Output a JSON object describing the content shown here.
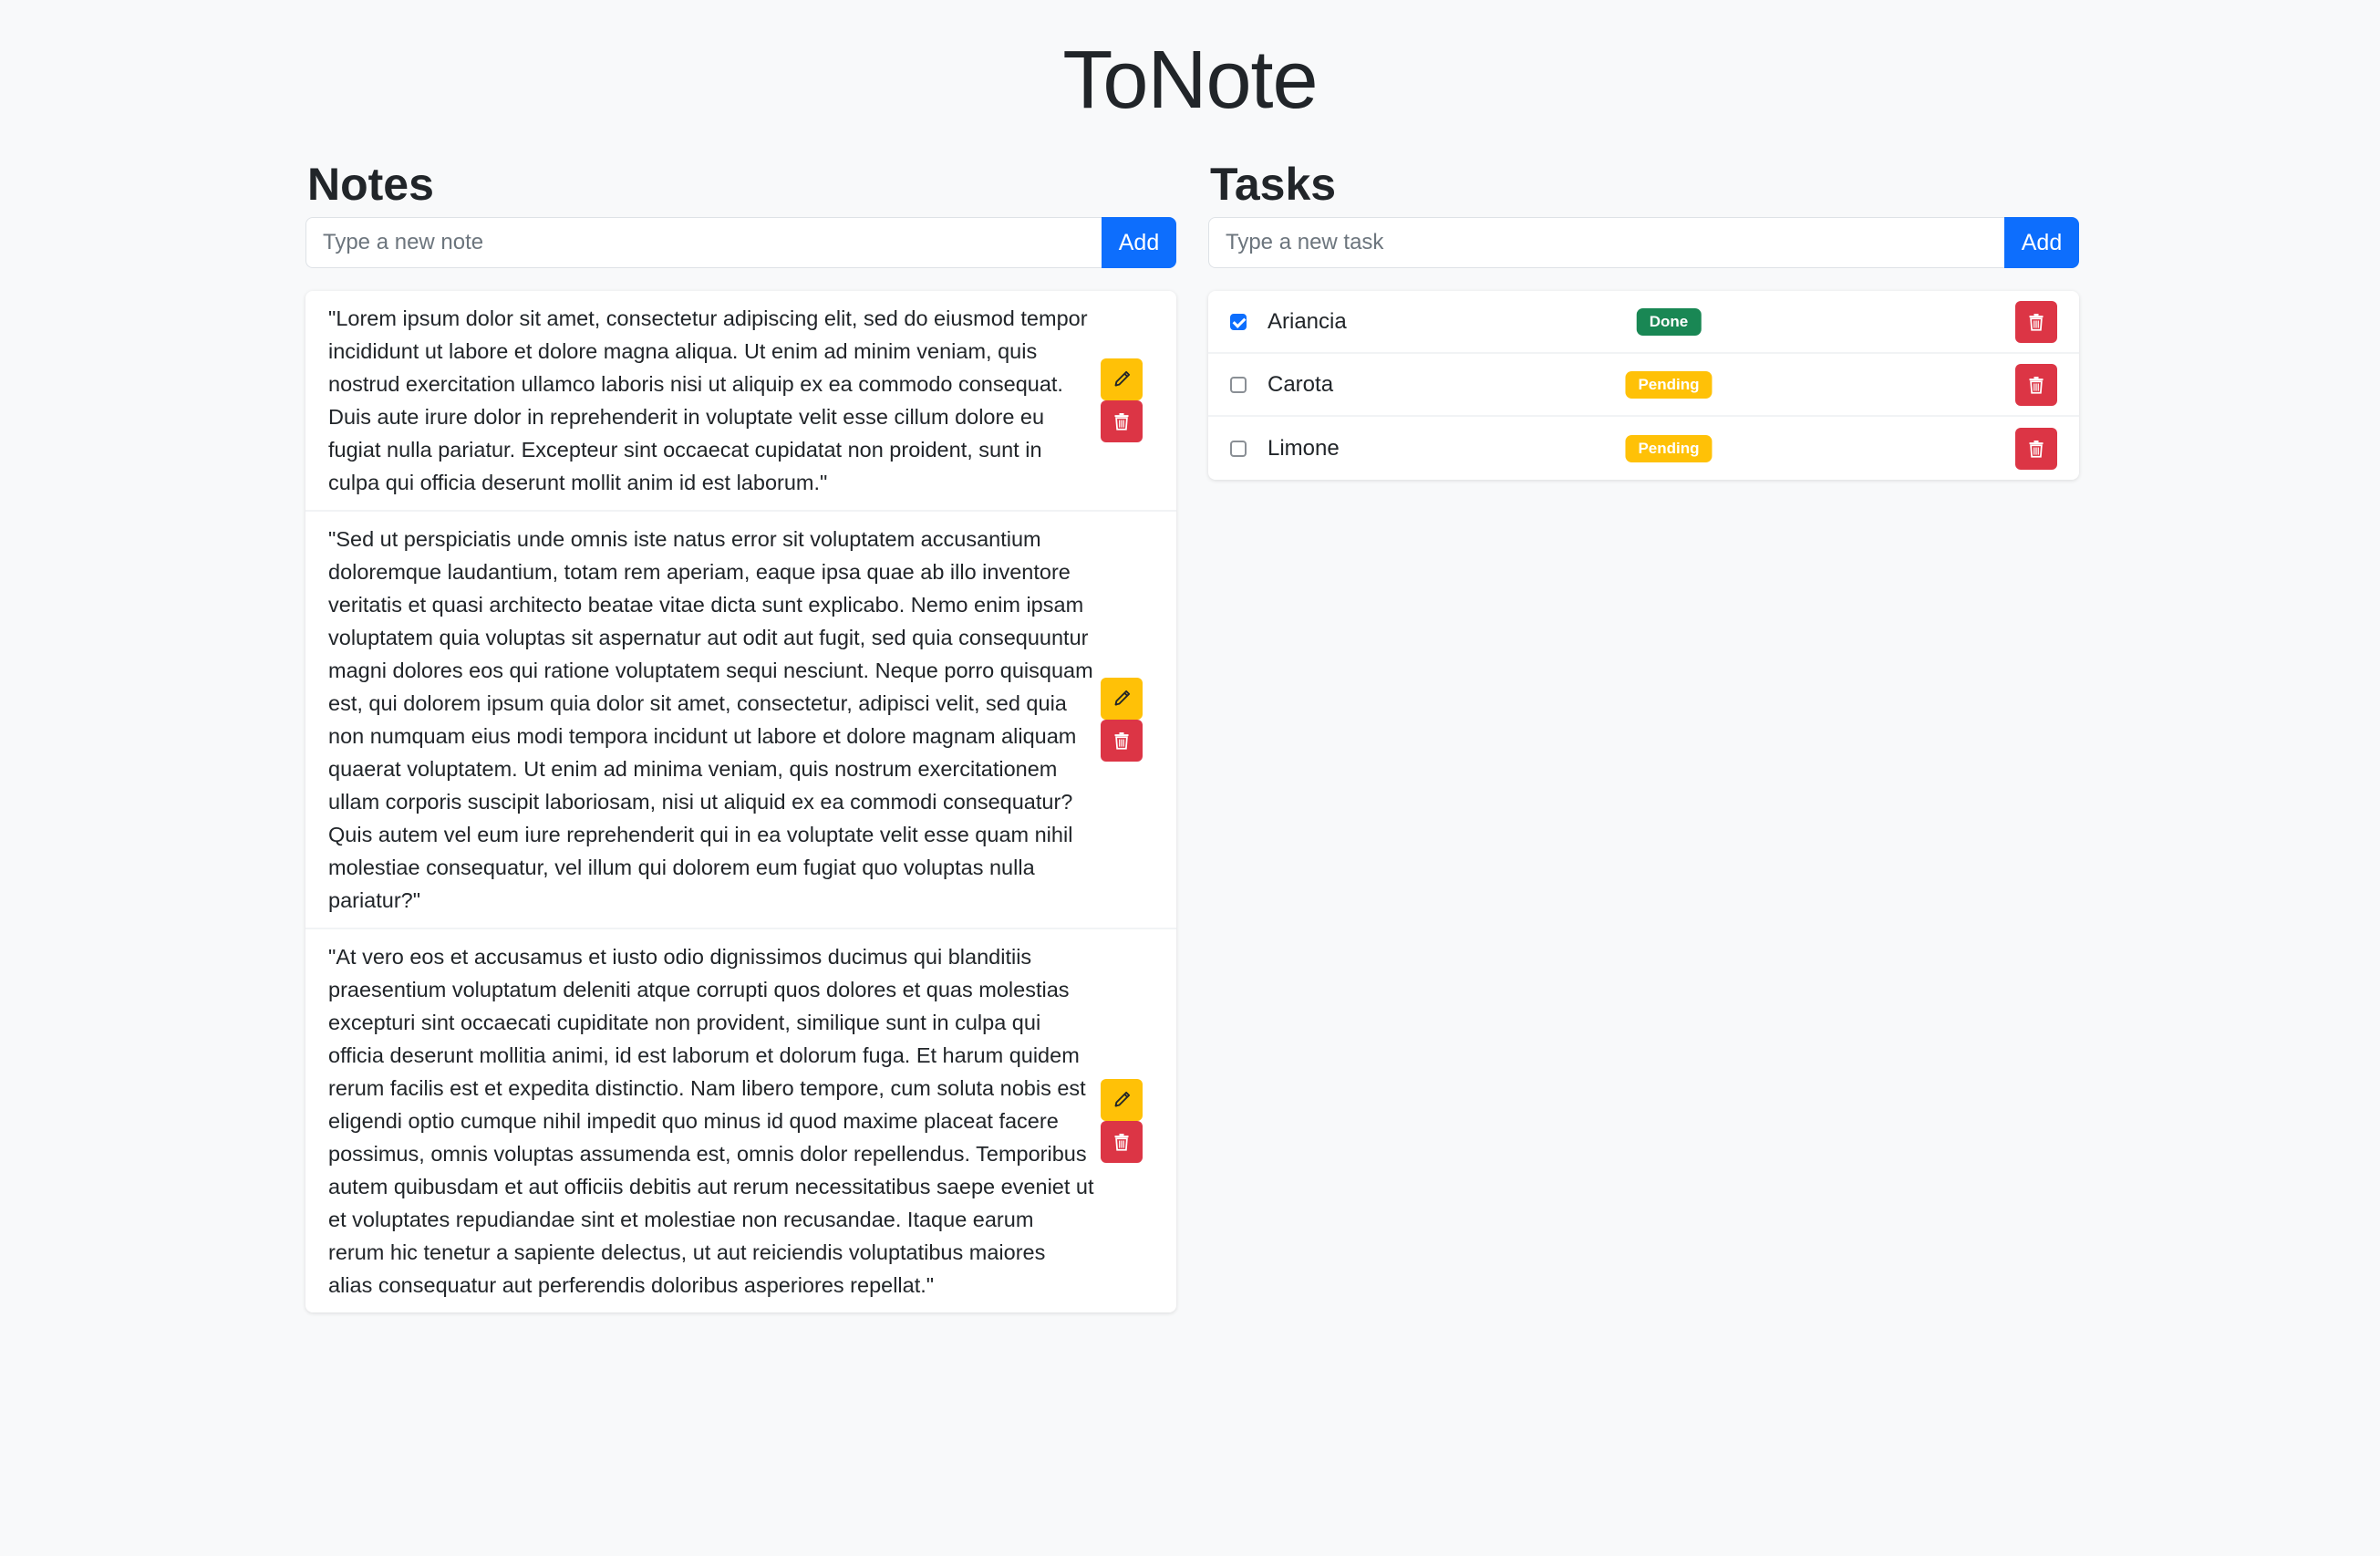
{
  "app": {
    "title": "ToNote"
  },
  "notes": {
    "heading": "Notes",
    "input_placeholder": "Type a new note",
    "add_label": "Add",
    "items": [
      {
        "text": "\"Lorem ipsum dolor sit amet, consectetur adipiscing elit, sed do eiusmod tempor incididunt ut labore et dolore magna aliqua. Ut enim ad minim veniam, quis nostrud exercitation ullamco laboris nisi ut aliquip ex ea commodo consequat. Duis aute irure dolor in reprehenderit in voluptate velit esse cillum dolore eu fugiat nulla pariatur. Excepteur sint occaecat cupidatat non proident, sunt in culpa qui officia deserunt mollit anim id est laborum.\""
      },
      {
        "text": "\"Sed ut perspiciatis unde omnis iste natus error sit voluptatem accusantium doloremque laudantium, totam rem aperiam, eaque ipsa quae ab illo inventore veritatis et quasi architecto beatae vitae dicta sunt explicabo. Nemo enim ipsam voluptatem quia voluptas sit aspernatur aut odit aut fugit, sed quia consequuntur magni dolores eos qui ratione voluptatem sequi nesciunt. Neque porro quisquam est, qui dolorem ipsum quia dolor sit amet, consectetur, adipisci velit, sed quia non numquam eius modi tempora incidunt ut labore et dolore magnam aliquam quaerat voluptatem. Ut enim ad minima veniam, quis nostrum exercitationem ullam corporis suscipit laboriosam, nisi ut aliquid ex ea commodi consequatur? Quis autem vel eum iure reprehenderit qui in ea voluptate velit esse quam nihil molestiae consequatur, vel illum qui dolorem eum fugiat quo voluptas nulla pariatur?\""
      },
      {
        "text": "\"At vero eos et accusamus et iusto odio dignissimos ducimus qui blanditiis praesentium voluptatum deleniti atque corrupti quos dolores et quas molestias excepturi sint occaecati cupiditate non provident, similique sunt in culpa qui officia deserunt mollitia animi, id est laborum et dolorum fuga. Et harum quidem rerum facilis est et expedita distinctio. Nam libero tempore, cum soluta nobis est eligendi optio cumque nihil impedit quo minus id quod maxime placeat facere possimus, omnis voluptas assumenda est, omnis dolor repellendus. Temporibus autem quibusdam et aut officiis debitis aut rerum necessitatibus saepe eveniet ut et voluptates repudiandae sint et molestiae non recusandae. Itaque earum rerum hic tenetur a sapiente delectus, ut aut reiciendis voluptatibus maiores alias consequatur aut perferendis doloribus asperiores repellat.\""
      }
    ]
  },
  "tasks": {
    "heading": "Tasks",
    "input_placeholder": "Type a new task",
    "add_label": "Add",
    "items": [
      {
        "name": "Ariancia",
        "checked": true,
        "status": "Done"
      },
      {
        "name": "Carota",
        "checked": false,
        "status": "Pending"
      },
      {
        "name": "Limone",
        "checked": false,
        "status": "Pending"
      }
    ]
  },
  "colors": {
    "primary": "#0d6efd",
    "warning": "#ffc107",
    "danger": "#dc3545",
    "success": "#198754",
    "background": "#f8f9fa"
  },
  "icons": {
    "edit": "pencil-icon",
    "delete": "trash-icon"
  }
}
